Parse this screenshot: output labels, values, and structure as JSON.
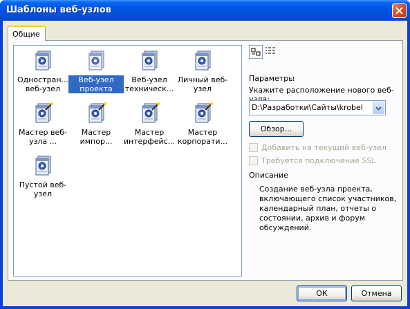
{
  "window": {
    "title": "Шаблоны веб-узлов"
  },
  "tabs": [
    {
      "label": "Общие",
      "active": true
    }
  ],
  "templates": [
    {
      "label": "Одностран... веб-узел",
      "icon": "single-page-site-icon",
      "selected": false
    },
    {
      "label": "Веб-узел проекта",
      "icon": "project-site-icon",
      "selected": true
    },
    {
      "label": "Веб-узел техническ...",
      "icon": "support-site-icon",
      "selected": false
    },
    {
      "label": "Личный веб-узел",
      "icon": "personal-site-icon",
      "selected": false
    },
    {
      "label": "Мастер веб-узла ...",
      "icon": "site-wizard-icon",
      "selected": false
    },
    {
      "label": "Мастер импор...",
      "icon": "import-wizard-icon",
      "selected": false
    },
    {
      "label": "Мастер интерфейс...",
      "icon": "interface-wizard-icon",
      "selected": false
    },
    {
      "label": "Мастер корпорати...",
      "icon": "corporate-wizard-icon",
      "selected": false
    },
    {
      "label": "Пустой веб-узел",
      "icon": "empty-site-icon",
      "selected": false
    }
  ],
  "options": {
    "section_label": "Параметры",
    "location_label": "Укажите расположение нового веб-узла:",
    "location_value": "D:\\Разработки\\Сайты\\krobel",
    "browse_label": "Обзор...",
    "add_to_current_label": "Добавить на текущий веб-узел",
    "add_to_current_checked": false,
    "ssl_label": "Требуется подключение SSL",
    "ssl_checked": false
  },
  "description": {
    "section_label": "Описание",
    "text": "Создание веб-узла проекта, включающего список участников, календарный план, отчеты о состоянии, архив и форум обсуждений."
  },
  "footer": {
    "ok_label": "ОК",
    "cancel_label": "Отмена"
  },
  "colors": {
    "selection": "#316ac5",
    "title_bar": "#0055e5",
    "dialog_bg": "#ece9d8"
  }
}
